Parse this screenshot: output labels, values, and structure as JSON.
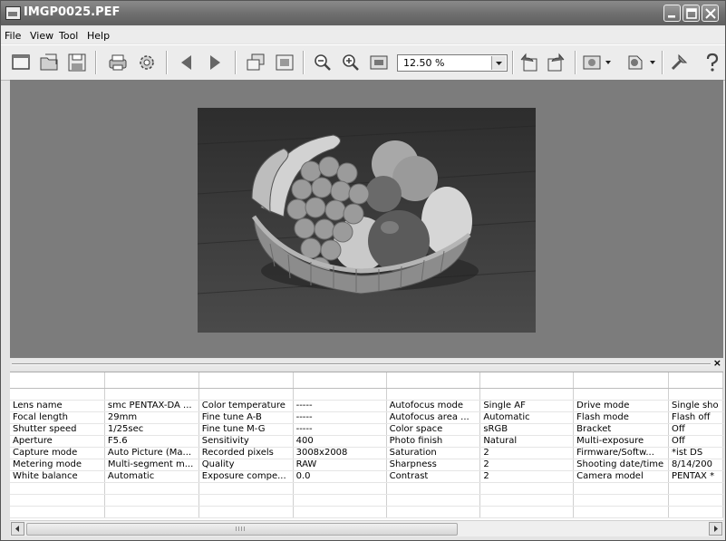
{
  "window": {
    "title": "IMGP0025.PEF"
  },
  "menu": [
    "File",
    "View",
    "Tool",
    "Help"
  ],
  "toolbar": {
    "zoom_value": "12.50 %"
  },
  "properties": {
    "rows": [
      [
        "Lens name",
        "smc PENTAX-DA ...",
        "Color temperature",
        "-----",
        "Autofocus mode",
        "Single AF",
        "Drive mode",
        "Single sho"
      ],
      [
        "Focal length",
        "29mm",
        "Fine tune A-B",
        "-----",
        "Autofocus area ...",
        "Automatic",
        "Flash mode",
        "Flash off"
      ],
      [
        "Shutter speed",
        "1/25sec",
        "Fine tune M-G",
        "-----",
        "Color space",
        "sRGB",
        "Bracket",
        "Off"
      ],
      [
        "Aperture",
        "F5.6",
        "Sensitivity",
        "400",
        "Photo finish",
        "Natural",
        "Multi-exposure",
        "Off"
      ],
      [
        "Capture mode",
        "Auto Picture (Ma...",
        "Recorded pixels",
        "3008x2008",
        "Saturation",
        "2",
        "Firmware/Softw...",
        "*ist DS"
      ],
      [
        "Metering mode",
        "Multi-segment m...",
        "Quality",
        "RAW",
        "Sharpness",
        "2",
        "Shooting date/time",
        "8/14/200"
      ],
      [
        "White balance",
        "Automatic",
        "Exposure compe...",
        "0.0",
        "Contrast",
        "2",
        "Camera model",
        "PENTAX *"
      ]
    ]
  },
  "icons": {
    "window_controls": [
      "minimize-icon",
      "maximize-icon",
      "close-icon"
    ],
    "toolbar": [
      "new-window-icon",
      "open-file-icon",
      "save-icon",
      "print-icon",
      "settings-icon",
      "previous-icon",
      "next-icon",
      "image-list-icon",
      "fit-window-icon",
      "zoom-out-icon",
      "zoom-in-icon",
      "actual-size-icon",
      "rotate-left-icon",
      "rotate-right-icon",
      "image-adjust-icon",
      "color-adjust-icon",
      "tools-icon",
      "help-icon"
    ]
  }
}
